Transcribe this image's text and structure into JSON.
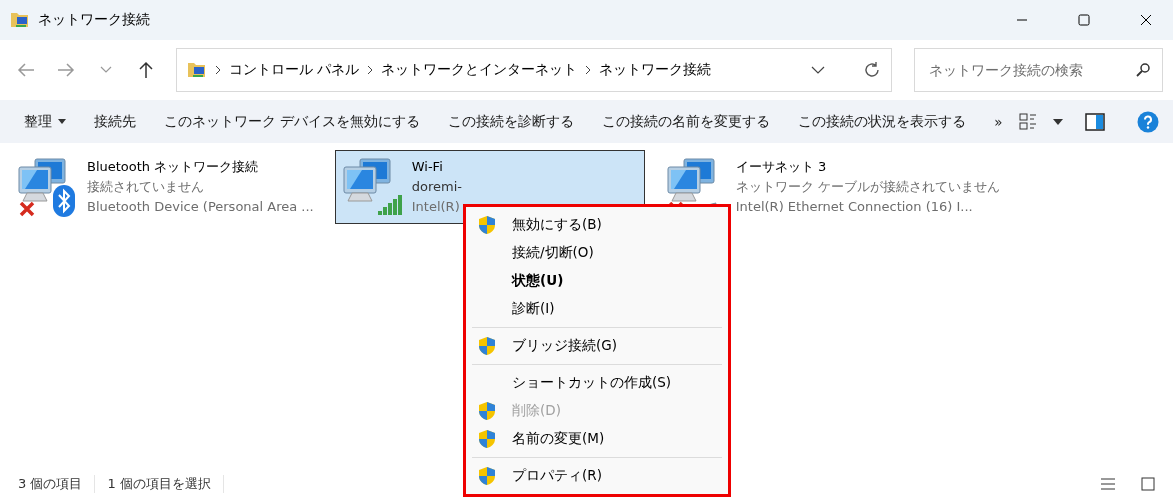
{
  "window": {
    "title": "ネットワーク接続"
  },
  "breadcrumb": [
    "コントロール パネル",
    "ネットワークとインターネット",
    "ネットワーク接続"
  ],
  "search": {
    "placeholder": "ネットワーク接続の検索"
  },
  "command_bar": [
    {
      "label": "整理",
      "kind": "menu"
    },
    {
      "label": "接続先",
      "kind": "plain"
    },
    {
      "label": "このネットワーク デバイスを無効にする",
      "kind": "plain"
    },
    {
      "label": "この接続を診断する",
      "kind": "plain"
    },
    {
      "label": "この接続の名前を変更する",
      "kind": "plain"
    },
    {
      "label": "この接続の状況を表示する",
      "kind": "plain"
    },
    {
      "label": "»",
      "kind": "overflow"
    }
  ],
  "connections": [
    {
      "name": "Bluetooth ネットワーク接続",
      "status": "接続されていません",
      "device": "Bluetooth Device (Personal Area ...",
      "kind": "bluetooth",
      "connected": false,
      "selected": false
    },
    {
      "name": "Wi-Fi",
      "status": "doremi-",
      "device": "Intel(R)",
      "kind": "wifi",
      "connected": true,
      "selected": true
    },
    {
      "name": "イーサネット 3",
      "status": "ネットワーク ケーブルが接続されていません",
      "device": "Intel(R) Ethernet Connection (16) I...",
      "kind": "ethernet",
      "connected": false,
      "selected": false
    }
  ],
  "context_menu": {
    "highlighted": true,
    "sections": [
      [
        {
          "label": "無効にする(B)",
          "shield": true,
          "bold": false,
          "disabled": false
        },
        {
          "label": "接続/切断(O)",
          "shield": false,
          "bold": false,
          "disabled": false
        },
        {
          "label": "状態(U)",
          "shield": false,
          "bold": true,
          "disabled": false
        },
        {
          "label": "診断(I)",
          "shield": false,
          "bold": false,
          "disabled": false
        }
      ],
      [
        {
          "label": "ブリッジ接続(G)",
          "shield": true,
          "bold": false,
          "disabled": false
        }
      ],
      [
        {
          "label": "ショートカットの作成(S)",
          "shield": false,
          "bold": false,
          "disabled": false
        },
        {
          "label": "削除(D)",
          "shield": true,
          "bold": false,
          "disabled": true
        },
        {
          "label": "名前の変更(M)",
          "shield": true,
          "bold": false,
          "disabled": false
        }
      ],
      [
        {
          "label": "プロパティ(R)",
          "shield": true,
          "bold": false,
          "disabled": false
        }
      ]
    ]
  },
  "status_bar": {
    "item_count": "3 個の項目",
    "selection": "1 個の項目を選択"
  }
}
